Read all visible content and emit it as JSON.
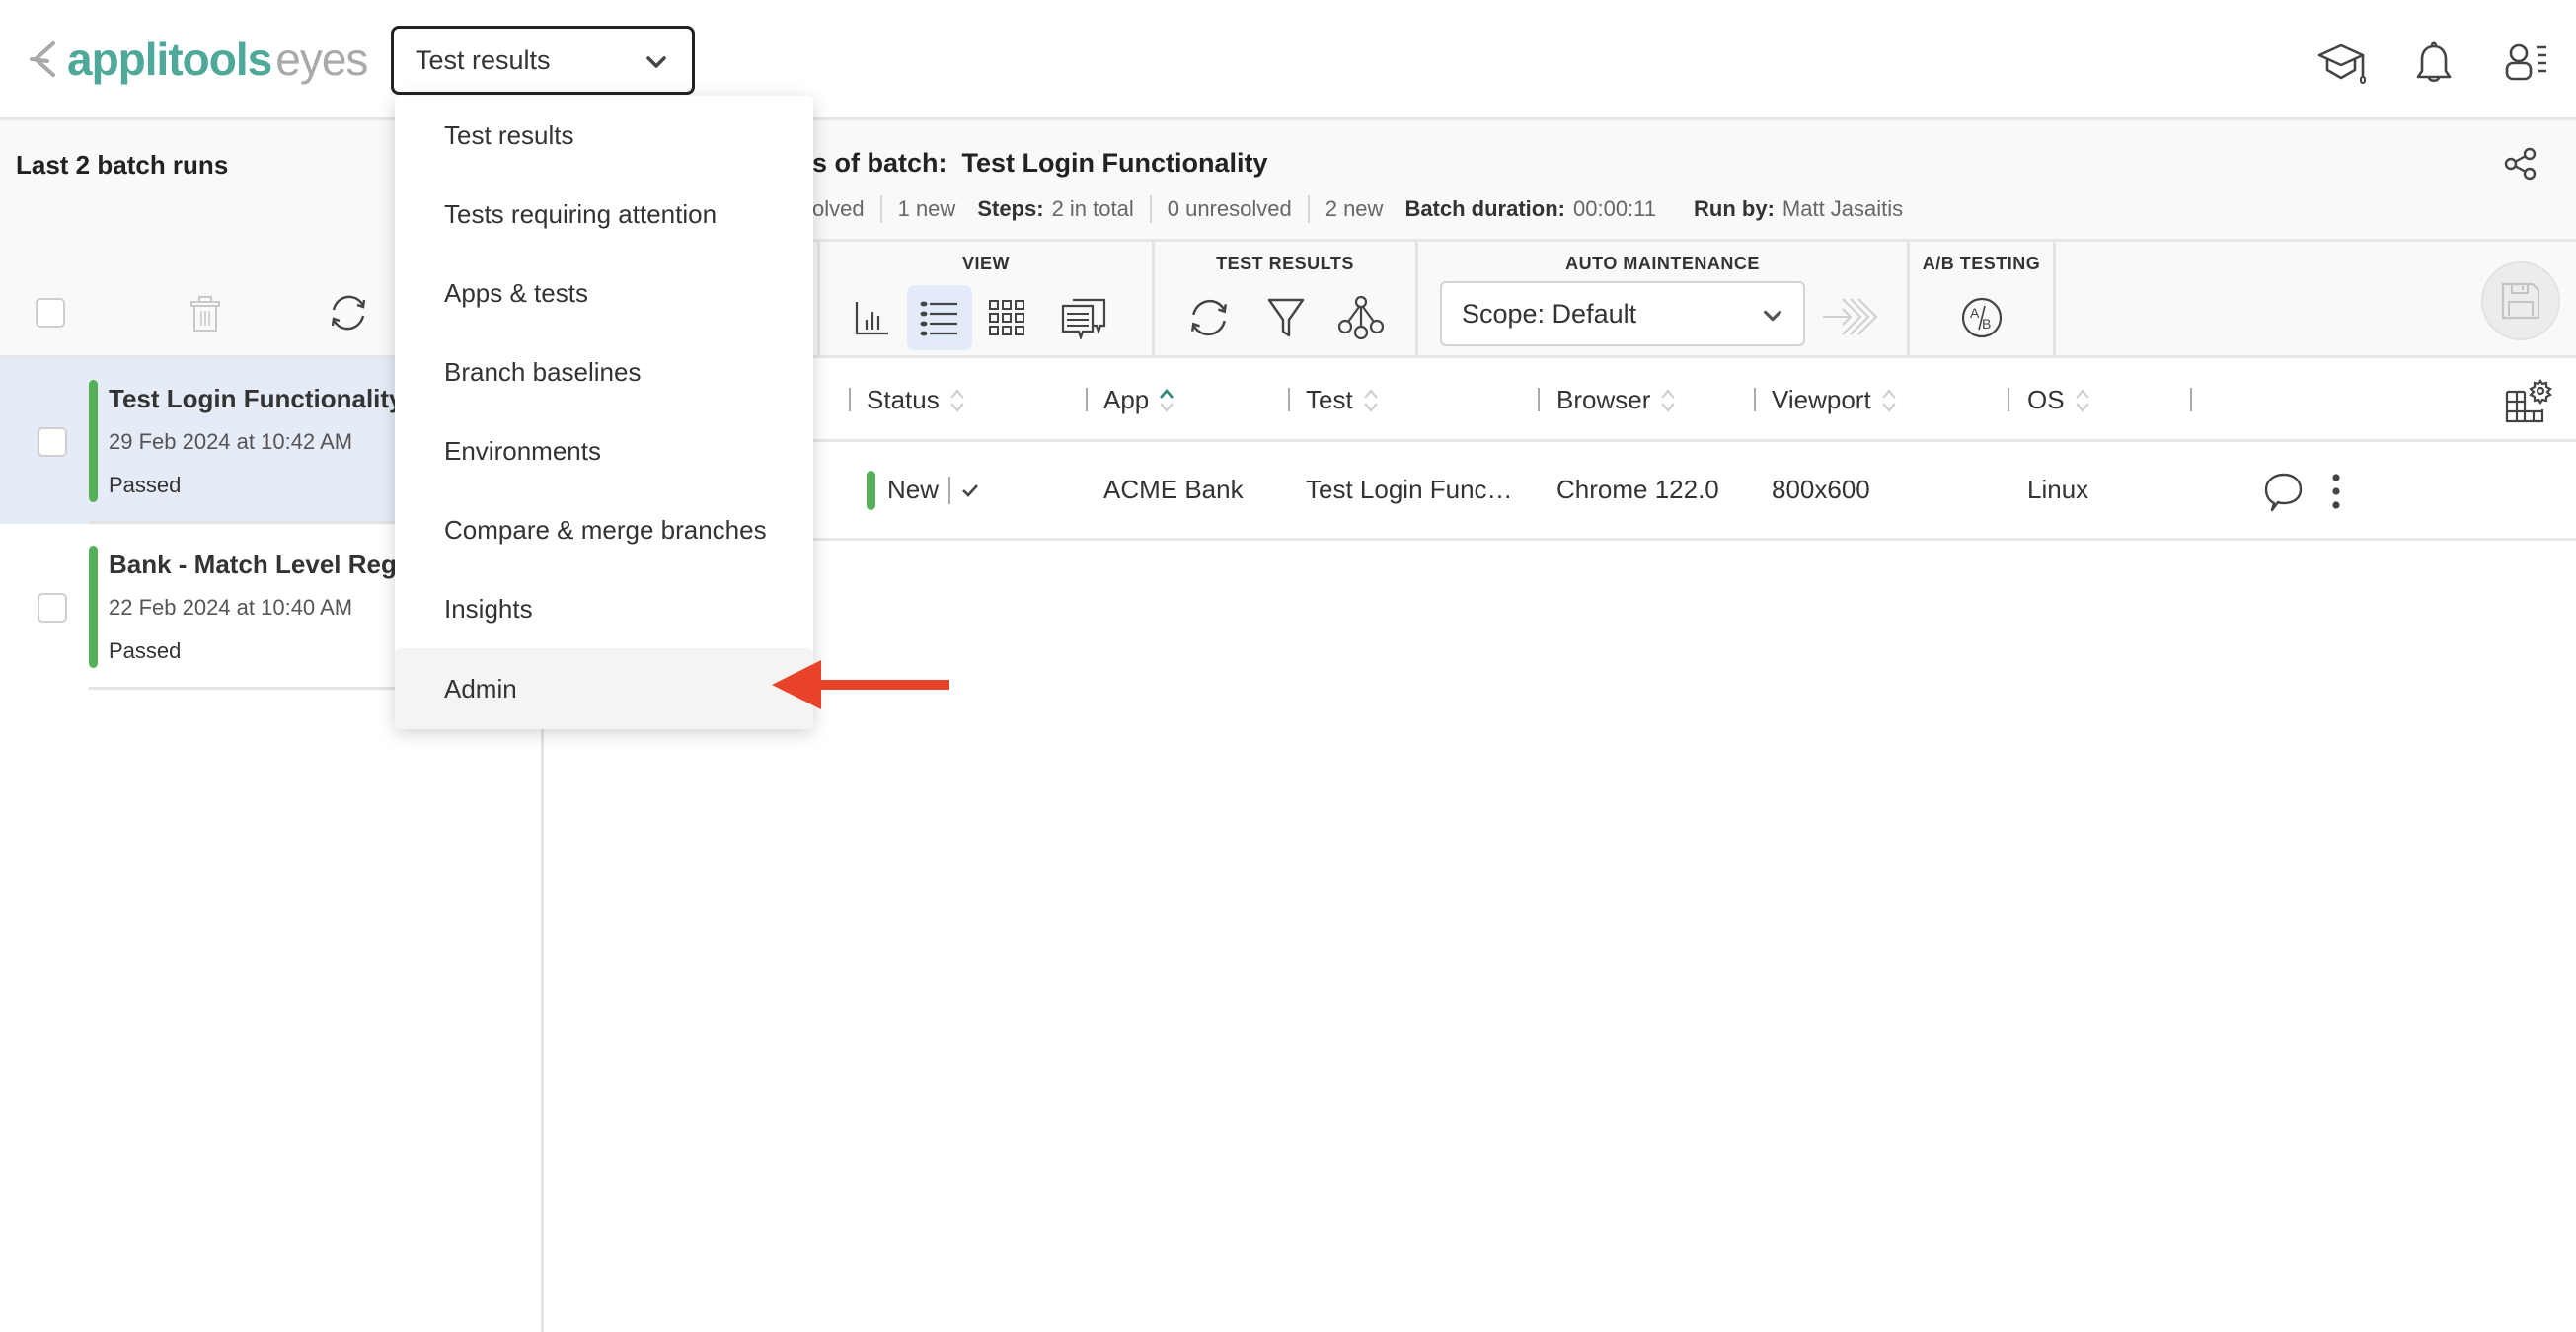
{
  "app": {
    "logo_primary": "applitools",
    "logo_secondary": "eyes",
    "brand_color": "#4ea99b",
    "nav_select": {
      "value": "Test results"
    },
    "top_icons": [
      "graduation-cap-icon",
      "bell-icon",
      "user-menu-icon"
    ]
  },
  "nav_menu": {
    "items": [
      {
        "label": "Test results"
      },
      {
        "label": "Tests requiring attention"
      },
      {
        "label": "Apps & tests"
      },
      {
        "label": "Branch baselines"
      },
      {
        "label": "Environments"
      },
      {
        "label": "Compare & merge branches"
      },
      {
        "label": "Insights"
      },
      {
        "label": "Admin",
        "highlighted": true
      }
    ]
  },
  "annotation": {
    "type": "arrow",
    "color": "#e8432a",
    "points_to": "Admin"
  },
  "sidebar": {
    "title": "Last 2 batch runs",
    "batches": [
      {
        "name": "Test Login Functionality",
        "date": "29 Feb 2024 at 10:42 AM",
        "status": "Passed",
        "selected": true,
        "status_color": "#56b05a"
      },
      {
        "name": "Bank - Match Level Regio",
        "date": "22 Feb 2024 at 10:40 AM",
        "status": "Passed",
        "selected": false,
        "status_color": "#56b05a"
      }
    ]
  },
  "batch_header": {
    "title_prefix_visible": "s of batch:",
    "title": "Test Login Functionality",
    "stats": {
      "tests_unresolved_visible": "olved",
      "tests_new": "1 new",
      "steps_label": "Steps:",
      "steps_total": "2 in total",
      "steps_unresolved": "0 unresolved",
      "steps_new": "2 new",
      "duration_label": "Batch duration:",
      "duration": "00:00:11",
      "run_by_label": "Run by:",
      "run_by": "Matt Jasaitis"
    }
  },
  "toolbar": {
    "view": {
      "label": "VIEW",
      "buttons": [
        "chart-view",
        "list-view",
        "grid-view",
        "comments-view"
      ],
      "active": "list-view"
    },
    "test_results": {
      "label": "TEST RESULTS",
      "buttons": [
        "refresh",
        "filter",
        "group-by"
      ]
    },
    "auto_maintenance": {
      "label": "AUTO MAINTENANCE",
      "scope": "Scope: Default"
    },
    "ab_testing": {
      "label": "A/B TESTING",
      "button": "A/B"
    }
  },
  "table": {
    "columns": [
      {
        "label": "Status",
        "sort": "none"
      },
      {
        "label": "App",
        "sort": "ascending"
      },
      {
        "label": "Test",
        "sort": "none"
      },
      {
        "label": "Browser",
        "sort": "none"
      },
      {
        "label": "Viewport",
        "sort": "none"
      },
      {
        "label": "OS",
        "sort": "none"
      }
    ],
    "rows": [
      {
        "status": "New",
        "status_accepted": true,
        "app": "ACME Bank",
        "test": "Test Login Func…",
        "browser": "Chrome 122.0",
        "viewport": "800x600",
        "os": "Linux"
      }
    ]
  }
}
